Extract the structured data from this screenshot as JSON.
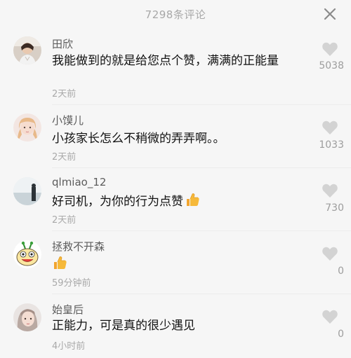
{
  "header": {
    "title": "7298条评论",
    "close_icon": "close-icon"
  },
  "comments": [
    {
      "username": "田欣",
      "text": "我能做到的就是给您点个赞，满满的正能量",
      "time": "2天前",
      "likes": "5038",
      "emoji": ""
    },
    {
      "username": "小馍儿",
      "text": "小孩家长怎么不稍微的弄弄啊。。",
      "time": "2天前",
      "likes": "1033",
      "emoji": ""
    },
    {
      "username": "qlmiao_12",
      "text": "好司机，为你的行为点赞",
      "time": "2天前",
      "likes": "730",
      "emoji": "thumbs-up-emoji"
    },
    {
      "username": "拯救不开森",
      "text": "",
      "time": "59分钟前",
      "likes": "0",
      "emoji": "thumbs-up-emoji"
    },
    {
      "username": "始皇后",
      "text": "正能力，可是真的很少遇见",
      "time": "4小时前",
      "likes": "0",
      "emoji": ""
    }
  ],
  "colors": {
    "background": "#f6f6f6",
    "heart": "#d3d3d3",
    "username": "#5c5c5c",
    "time": "#a9a9a9",
    "thumb": "#f6b93a"
  }
}
